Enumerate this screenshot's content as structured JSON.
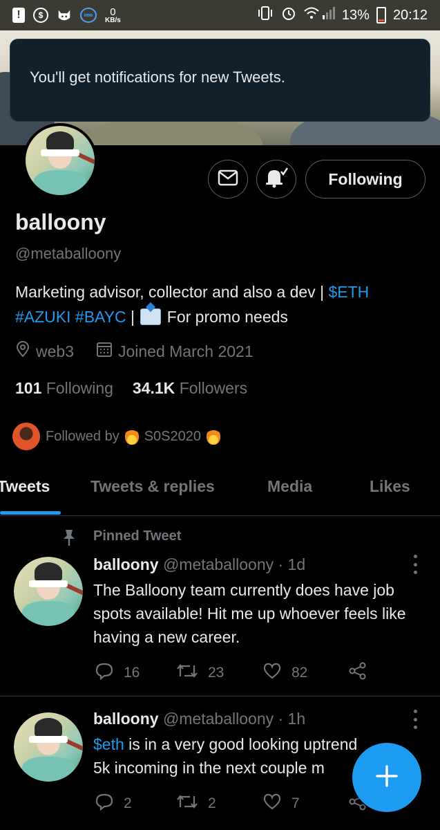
{
  "status_bar": {
    "speed_value": "0",
    "speed_unit": "KB/s",
    "imo_label": "imo",
    "battery": "13%",
    "time": "20:12"
  },
  "toast": {
    "message": "You'll get notifications for new Tweets."
  },
  "profile": {
    "name": "balloony",
    "handle": "@metaballoony",
    "bio_prefix": "Marketing advisor, collector and also a dev | ",
    "bio_eth": "$ETH",
    "bio_azuki": "#AZUKI",
    "bio_bayc": "#BAYC",
    "bio_sep": " | ",
    "bio_suffix": " For promo needs",
    "location": "web3",
    "joined": "Joined March 2021",
    "following_count": "101",
    "following_label": "Following",
    "followers_count": "34.1K",
    "followers_label": "Followers",
    "followed_by_label": "Followed by",
    "followed_by_name": "S0S2020",
    "follow_button": "Following"
  },
  "tabs": [
    {
      "label": "Tweets",
      "active": true
    },
    {
      "label": "Tweets & replies",
      "active": false
    },
    {
      "label": "Media",
      "active": false
    },
    {
      "label": "Likes",
      "active": false
    }
  ],
  "pinned_label": "Pinned Tweet",
  "tweets": [
    {
      "name": "balloony",
      "meta": "@metaballoony · 1d",
      "text": "The Balloony team currently does have job spots available! Hit me up whoever feels like having a new career.",
      "replies": "16",
      "retweets": "23",
      "likes": "82"
    },
    {
      "name": "balloony",
      "meta": "@metaballoony · 1h",
      "text_link": "$eth",
      "text_line1": " is in a very good looking uptrend",
      "text_line2": "5k incoming in the next couple m",
      "replies": "2",
      "retweets": "2",
      "likes": "7"
    }
  ],
  "colors": {
    "accent": "#1d9bf0",
    "background": "#000000",
    "muted": "#71767b",
    "text": "#e7e9ea"
  }
}
